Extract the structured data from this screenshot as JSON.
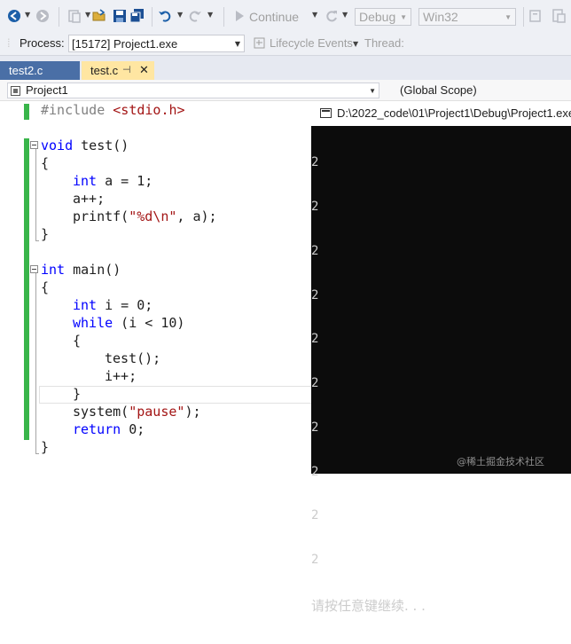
{
  "toolbar": {
    "continue_label": "Continue",
    "config_value": "Debug",
    "platform_value": "Win32"
  },
  "process_bar": {
    "process_label": "Process:",
    "process_value": "[15172] Project1.exe",
    "lifecycle_label": "Lifecycle Events",
    "thread_label": "Thread:"
  },
  "tabs": [
    {
      "label": "test2.c",
      "active": false
    },
    {
      "label": "test.c",
      "active": true,
      "pin_icon": "pin-icon",
      "close_icon": "close-icon"
    }
  ],
  "navbar": {
    "project_value": "Project1",
    "scope_value": "(Global Scope)"
  },
  "code": {
    "line1": {
      "pp": "#include",
      "hdr": "<stdio.h>"
    },
    "line2": {
      "kw": "void",
      "rest": " test()"
    },
    "line3": "{",
    "line4": {
      "kw": "int",
      "rest": " a = 1;"
    },
    "line5": "a++;",
    "line6": {
      "pre": "printf(",
      "str": "\"%d\\n\"",
      "post": ", a);"
    },
    "line7": "}",
    "line8": {
      "kw": "int",
      "rest": " main()"
    },
    "line9": "{",
    "line10": {
      "kw": "int",
      "rest": " i = 0;"
    },
    "line11": {
      "kw": "while",
      "rest": " (i < 10)"
    },
    "line12": "{",
    "line13": "test();",
    "line14": "i++;",
    "line15": "}",
    "line16": {
      "pre": "system(",
      "str": "\"pause\"",
      "post": ");"
    },
    "line17": {
      "kw": "return",
      "rest": " 0;"
    },
    "line18": "}"
  },
  "console": {
    "title": "D:\\2022_code\\01\\Project1\\Debug\\Project1.exe",
    "output_lines": [
      "2",
      "2",
      "2",
      "2",
      "2",
      "2",
      "2",
      "2",
      "2",
      "2"
    ],
    "pause_text": "请按任意键继续. . ."
  },
  "watermark": "@稀土掘金技术社区"
}
